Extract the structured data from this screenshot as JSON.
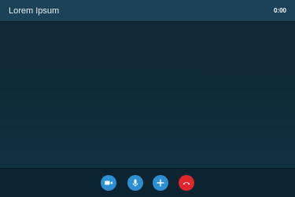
{
  "header": {
    "title": "Lorem Ipsum",
    "timer": "0:00"
  },
  "controls": {
    "video_icon": "video-camera-icon",
    "mic_icon": "microphone-icon",
    "add_icon": "plus-icon",
    "end_icon": "phone-hangup-icon"
  },
  "colors": {
    "header_bg": "#1c4257",
    "background": "#0f2a37",
    "button_blue": "#2c8fd4",
    "button_red": "#e0252c"
  }
}
